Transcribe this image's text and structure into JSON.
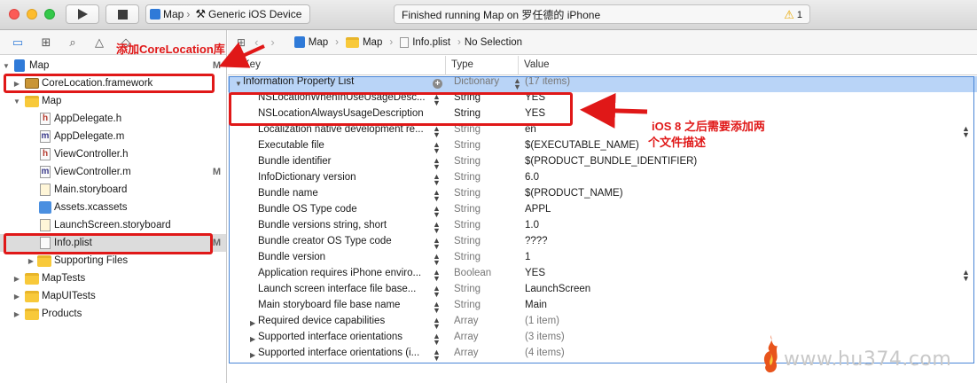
{
  "titlebar": {
    "scheme_target": "Map",
    "scheme_device": "Generic iOS Device",
    "status_text": "Finished running Map on 罗任德的 iPhone",
    "warning_count": "1"
  },
  "jumpbar": {
    "crumbs": [
      "Map",
      "Map",
      "Info.plist",
      "No Selection"
    ]
  },
  "navigator": {
    "items": [
      {
        "label": "Map",
        "badge": "M"
      },
      {
        "label": "CoreLocation.framework"
      },
      {
        "label": "Map"
      },
      {
        "label": "AppDelegate.h"
      },
      {
        "label": "AppDelegate.m"
      },
      {
        "label": "ViewController.h"
      },
      {
        "label": "ViewController.m",
        "badge": "M"
      },
      {
        "label": "Main.storyboard"
      },
      {
        "label": "Assets.xcassets"
      },
      {
        "label": "LaunchScreen.storyboard"
      },
      {
        "label": "Info.plist",
        "badge": "M"
      },
      {
        "label": "Supporting Files"
      },
      {
        "label": "MapTests"
      },
      {
        "label": "MapUITests"
      },
      {
        "label": "Products"
      }
    ]
  },
  "plist": {
    "headers": {
      "key": "Key",
      "type": "Type",
      "value": "Value"
    },
    "rows": [
      {
        "key": "Information Property List",
        "type": "Dictionary",
        "value": "(17 items)"
      },
      {
        "key": "NSLocationWhenInUseUsageDesc...",
        "type": "String",
        "value": "YES"
      },
      {
        "key": "NSLocationAlwaysUsageDescription",
        "type": "String",
        "value": "YES"
      },
      {
        "key": "Localization native development re...",
        "type": "String",
        "value": "en"
      },
      {
        "key": "Executable file",
        "type": "String",
        "value": "$(EXECUTABLE_NAME)"
      },
      {
        "key": "Bundle identifier",
        "type": "String",
        "value": "$(PRODUCT_BUNDLE_IDENTIFIER)"
      },
      {
        "key": "InfoDictionary version",
        "type": "String",
        "value": "6.0"
      },
      {
        "key": "Bundle name",
        "type": "String",
        "value": "$(PRODUCT_NAME)"
      },
      {
        "key": "Bundle OS Type code",
        "type": "String",
        "value": "APPL"
      },
      {
        "key": "Bundle versions string, short",
        "type": "String",
        "value": "1.0"
      },
      {
        "key": "Bundle creator OS Type code",
        "type": "String",
        "value": "????"
      },
      {
        "key": "Bundle version",
        "type": "String",
        "value": "1"
      },
      {
        "key": "Application requires iPhone enviro...",
        "type": "Boolean",
        "value": "YES"
      },
      {
        "key": "Launch screen interface file base...",
        "type": "String",
        "value": "LaunchScreen"
      },
      {
        "key": "Main storyboard file base name",
        "type": "String",
        "value": "Main"
      },
      {
        "key": "Required device capabilities",
        "type": "Array",
        "value": "(1 item)"
      },
      {
        "key": "Supported interface orientations",
        "type": "Array",
        "value": "(3 items)"
      },
      {
        "key": "Supported interface orientations (i...",
        "type": "Array",
        "value": "(4 items)"
      }
    ]
  },
  "annotations": {
    "add_framework": "添加CoreLocation库",
    "ios8_line1": "iOS 8 之后需要添加两",
    "ios8_line2": "个文件描述"
  },
  "watermark": "www.hu374.com",
  "colors": {
    "annotation": "#e01818",
    "selection": "#b9d4f7",
    "accent": "#2f7ad8"
  }
}
